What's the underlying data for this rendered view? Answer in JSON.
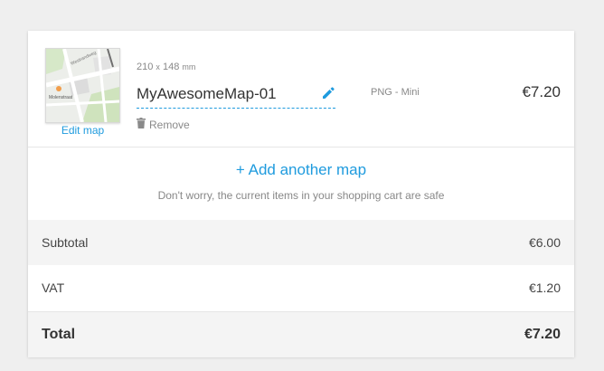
{
  "item": {
    "dimensions_value": "210",
    "dimensions_sep": "x",
    "dimensions_value2": "148",
    "dimensions_unit": "mm",
    "name": "MyAwesomeMap-01",
    "format": "PNG - Mini",
    "price": "€7.20",
    "edit_label": "Edit map",
    "remove_label": "Remove",
    "thumb_labels": [
      "Westrandweg",
      "Molenstraat"
    ],
    "icons": {
      "edit": "pencil-icon",
      "remove": "trash-icon"
    }
  },
  "add_another": {
    "label": "+ Add another map",
    "note": "Don't worry, the current items in your shopping cart are safe"
  },
  "totals": {
    "subtotal_label": "Subtotal",
    "subtotal_value": "€6.00",
    "vat_label": "VAT",
    "vat_value": "€1.20",
    "total_label": "Total",
    "total_value": "€7.20"
  },
  "colors": {
    "accent": "#1f9bde",
    "muted": "#888888",
    "background": "#efefef"
  }
}
